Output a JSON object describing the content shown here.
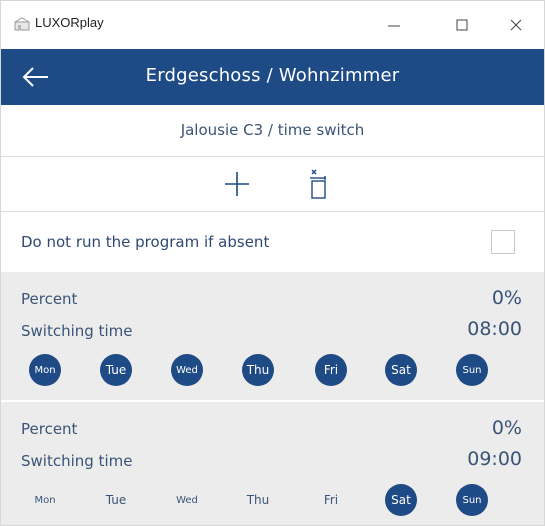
{
  "titlebar": {
    "app_title": "LUXORplay",
    "minimize_glyph": "—",
    "maximize_glyph": "☐",
    "close_glyph": "✕"
  },
  "header": {
    "back_icon": "arrow-left-icon",
    "title": "Erdgeschoss / Wohnzimmer",
    "color": "#1e4a85"
  },
  "subtitle": "Jalousie C3 / time switch",
  "toolbar": {
    "add_icon": "plus-icon",
    "delete_icon": "trash-icon"
  },
  "absent_option": {
    "label": "Do not run the program if absent",
    "checked": false
  },
  "programs": [
    {
      "percent_label": "Percent",
      "percent_value": "0%",
      "time_label": "Switching time",
      "time_value": "08:00",
      "days": [
        {
          "label": "Mon",
          "active": true
        },
        {
          "label": "Tue",
          "active": true
        },
        {
          "label": "Wed",
          "active": true
        },
        {
          "label": "Thu",
          "active": true
        },
        {
          "label": "Fri",
          "active": true
        },
        {
          "label": "Sat",
          "active": true
        },
        {
          "label": "Sun",
          "active": true
        }
      ]
    },
    {
      "percent_label": "Percent",
      "percent_value": "0%",
      "time_label": "Switching time",
      "time_value": "09:00",
      "days": [
        {
          "label": "Mon",
          "active": false
        },
        {
          "label": "Tue",
          "active": false
        },
        {
          "label": "Wed",
          "active": false
        },
        {
          "label": "Thu",
          "active": false
        },
        {
          "label": "Fri",
          "active": false
        },
        {
          "label": "Sat",
          "active": true
        },
        {
          "label": "Sun",
          "active": true
        }
      ]
    }
  ]
}
